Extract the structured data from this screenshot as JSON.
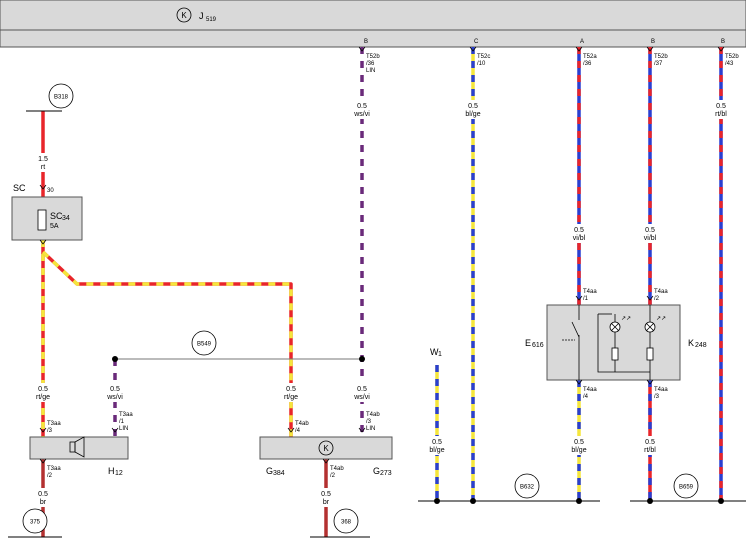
{
  "header": {
    "control_unit_symbol": "K",
    "control_unit_name": "J",
    "control_unit_sub": "519"
  },
  "bus_pins": {
    "b1": "B",
    "c": "C",
    "a": "A",
    "b2": "B",
    "b3": "B"
  },
  "connectors": {
    "t52b_36": [
      "T52b",
      "/36",
      "LIN"
    ],
    "t52c_10": [
      "T52c",
      "/10"
    ],
    "t52a_36": [
      "T52a",
      "/36"
    ],
    "t52b_37": [
      "T52b",
      "/37"
    ],
    "t52b_43": [
      "T52b",
      "/43"
    ],
    "t3aa_3": [
      "T3aa",
      "/3"
    ],
    "t3aa_1": [
      "T3aa",
      "/1",
      "LIN"
    ],
    "t4ab_4": [
      "T4ab",
      "/4"
    ],
    "t4ab_3": [
      "T4ab",
      "/3",
      "LIN"
    ],
    "t3aa_2": [
      "T3aa",
      "/2"
    ],
    "t4ab_2": [
      "T4ab",
      "/2"
    ],
    "t4aa_1": [
      "T4aa",
      "/1"
    ],
    "t4aa_2": [
      "T4aa",
      "/2"
    ],
    "t4aa_4": [
      "T4aa",
      "/4"
    ],
    "t4aa_3": [
      "T4aa",
      "/3"
    ],
    "pin30": "30"
  },
  "wires": {
    "lin_top": [
      "0.5",
      "ws/vi"
    ],
    "blge_top": [
      "0.5",
      "bl/ge"
    ],
    "vibl_top": [
      "0.5",
      "rt/bl"
    ],
    "fuse_feed": [
      "1.5",
      "rt"
    ],
    "vibl_a": [
      "0.5",
      "vi/bl"
    ],
    "vibl_b": [
      "0.5",
      "vi/bl"
    ],
    "rtge_1": [
      "0.5",
      "rt/ge"
    ],
    "wsvi_h": [
      "0.5",
      "ws/vi"
    ],
    "rtge_2": [
      "0.5",
      "rt/ge"
    ],
    "wsvi_g": [
      "0.5",
      "ws/vi"
    ],
    "br_1": [
      "0.5",
      "br"
    ],
    "br_2": [
      "0.5",
      "br"
    ],
    "blge_w": [
      "0.5",
      "bl/ge"
    ],
    "blge_e": [
      "0.5",
      "bl/ge"
    ],
    "rtbl_k": [
      "0.5",
      "rt/bl"
    ]
  },
  "nodes": {
    "b318": "B318",
    "b549": "B549",
    "n375": "375",
    "n368": "368",
    "b632": "B632",
    "b659": "B659"
  },
  "components": {
    "sc_label": "SC",
    "fuse_name": "SC",
    "fuse_sub": "34",
    "fuse_rating": "5A",
    "h_name": "H",
    "h_sub": "12",
    "g384_name": "G",
    "g384_sub": "384",
    "g273_name": "G",
    "g273_sub": "273",
    "k_symbol": "K",
    "w_name": "W",
    "w_sub": "1",
    "e_name": "E",
    "e_sub": "616",
    "k_name": "K",
    "k_sub": "248"
  },
  "colors": {
    "red": "#e8252a",
    "yellow": "#f5e63c",
    "blue": "#2a3fd0",
    "violet": "#6a2a7a",
    "white": "#ffffff",
    "brown": "#b33030",
    "box_fill": "#d9d9d9"
  }
}
